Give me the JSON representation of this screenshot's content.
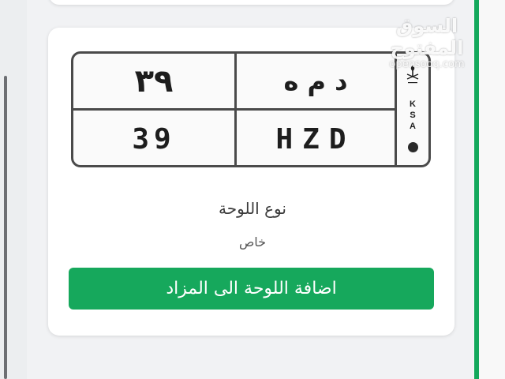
{
  "colors": {
    "accent_green": "#16a85c",
    "plate_border": "#4a4a4a"
  },
  "watermark": {
    "brand_ar": "السوق المفتوح",
    "brand_en": "opensooq.com"
  },
  "plate": {
    "arabic_numbers": "٣٩",
    "arabic_letters": "د م ه",
    "english_numbers": "39",
    "english_letters": "HZD",
    "country": [
      "K",
      "S",
      "A"
    ],
    "emblem_icon": "saudi-emblem-icon"
  },
  "details": {
    "type_label": "نوع اللوحة",
    "type_value": "خاص"
  },
  "actions": {
    "add_plate_label": "اضافة اللوحة الى المزاد"
  }
}
